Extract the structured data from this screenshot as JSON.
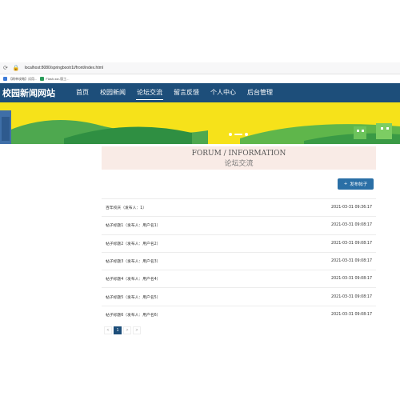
{
  "browser": {
    "url": "localhost:8080/springbootr1t/front/index.html",
    "bookmarks": [
      "【刷单攻略】试用...",
      "Flash-ssr-版工..."
    ]
  },
  "nav": {
    "logo": "校园新闻网站",
    "items": [
      "首页",
      "校园新闻",
      "论坛交流",
      "留言反馈",
      "个人中心",
      "后台管理"
    ],
    "active_index": 2
  },
  "header": {
    "title_en": "FORUM / INFORMATION",
    "title_cn": "论坛交流"
  },
  "post_button": {
    "icon": "plus-icon",
    "label": "发布帖子"
  },
  "posts": [
    {
      "title": "百年校庆（发布人：1）",
      "time": "2021-03-31 09:36:17"
    },
    {
      "title": "帖子标题1（发布人：用户名1）",
      "time": "2021-03-31 09:08:17"
    },
    {
      "title": "帖子标题2（发布人：用户名2）",
      "time": "2021-03-31 09:08:17"
    },
    {
      "title": "帖子标题3（发布人：用户名3）",
      "time": "2021-03-31 09:08:17"
    },
    {
      "title": "帖子标题4（发布人：用户名4）",
      "time": "2021-03-31 09:08:17"
    },
    {
      "title": "帖子标题5（发布人：用户名5）",
      "time": "2021-03-31 09:08:17"
    },
    {
      "title": "帖子标题6（发布人：用户名6）",
      "time": "2021-03-31 09:08:17"
    }
  ],
  "pagination": {
    "prev": "<",
    "current": "1",
    "next": ">",
    "more": ">"
  },
  "colors": {
    "nav_bg": "#1d4e7a",
    "banner_yellow": "#f6e21a",
    "accent": "#2a6fa6"
  }
}
